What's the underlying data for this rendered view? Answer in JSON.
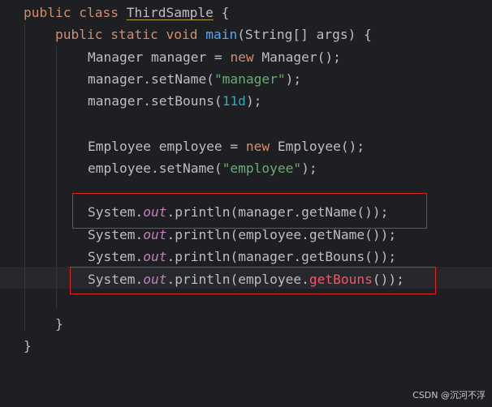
{
  "code": {
    "l1": {
      "kw1": "public",
      "kw2": "class",
      "name": "ThirdSample",
      "brace": "{"
    },
    "l2": {
      "kw1": "public",
      "kw2": "static",
      "kw3": "void",
      "fn": "main",
      "params": "(String[] args) {"
    },
    "l3": {
      "a": "Manager manager = ",
      "kw": "new",
      "b": " Manager();"
    },
    "l4": {
      "a": "manager.setName(",
      "str": "\"manager\"",
      "b": ");"
    },
    "l5": {
      "a": "manager.setBouns(",
      "num": "11d",
      "b": ");"
    },
    "l7": {
      "a": "Employee employee = ",
      "kw": "new",
      "b": " Employee();"
    },
    "l8": {
      "a": "employee.setName(",
      "str": "\"employee\"",
      "b": ");"
    },
    "l10": {
      "a": "System.",
      "fld": "out",
      "b": ".println(manager.getName());"
    },
    "l11": {
      "a": "System.",
      "fld": "out",
      "b": ".println(employee.getName());"
    },
    "l12": {
      "a": "System.",
      "fld": "out",
      "b": ".println(manager.getBouns());"
    },
    "l13": {
      "a": "System.",
      "fld": "out",
      "b": ".println(employee.",
      "red": "getBouns",
      "c": "());"
    },
    "l15": {
      "text": "}"
    },
    "l16": {
      "text": "}"
    }
  },
  "annotations": {
    "color": "#e02323"
  },
  "watermark": "CSDN @沉河不浮"
}
